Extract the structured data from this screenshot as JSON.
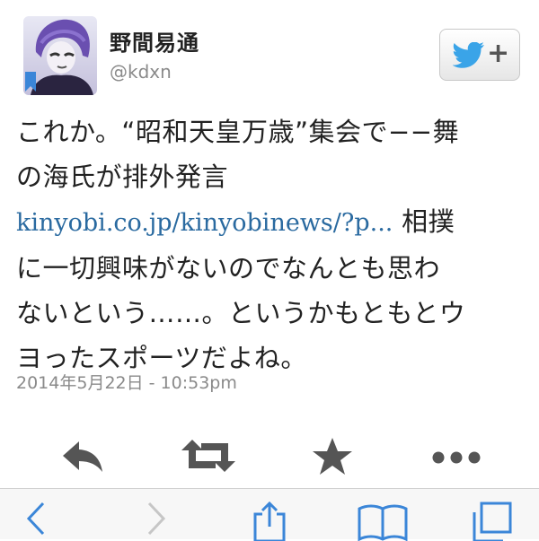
{
  "user": {
    "display_name": "野間易通",
    "handle": "@kdxn"
  },
  "tweet": {
    "lines": [
      "これか。“昭和天皇万歳”集会で−−舞",
      "の海氏が排外発言"
    ],
    "link": "kinyobi.co.jp/kinyobinews/?p...",
    "after_link": " 相撲",
    "lines2": [
      "に一切興味がないのでなんとも思わ",
      "ないという……。というかもともとウ",
      "ヨったスポーツだよね。"
    ],
    "timestamp": "2014年5月22日 - 10:53pm"
  },
  "actions": [
    "reply-icon",
    "retweet-icon",
    "favorite-icon",
    "more-icon"
  ],
  "toolbar": [
    "back-icon",
    "forward-icon",
    "share-icon",
    "bookmarks-icon",
    "tabs-icon"
  ],
  "colors": {
    "link": "#2a6aa0",
    "twitter_blue": "#3aa4e8",
    "icon_gray": "#555555",
    "toolbar_blue": "#3b86d8"
  }
}
